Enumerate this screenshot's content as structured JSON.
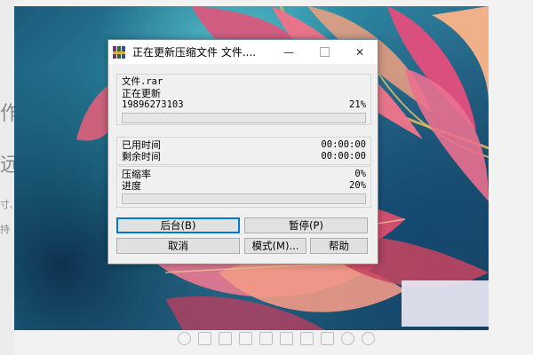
{
  "background_doc": {
    "fragment_1": "作",
    "fragment_2": "远",
    "fragment_3": "寸,",
    "fragment_4": "持"
  },
  "dialog": {
    "title": "正在更新压缩文件 文件....",
    "window_controls": {
      "minimize": "—",
      "maximize": "□",
      "close": "✕"
    },
    "file_section": {
      "filename": "文件.rar",
      "status": "正在更新",
      "current_item": "19896273103",
      "current_percent": "21%",
      "current_progress": 0
    },
    "time_section": {
      "elapsed_label": "已用时间",
      "elapsed_value": "00:00:00",
      "remaining_label": "剩余时间",
      "remaining_value": "00:00:00"
    },
    "ratio_section": {
      "ratio_label": "压缩率",
      "ratio_value": "0%",
      "progress_label": "进度",
      "progress_value": "20%",
      "total_progress": 0
    },
    "buttons": {
      "background": "后台(B)",
      "pause": "暂停(P)",
      "cancel": "取消",
      "mode": "模式(M)...",
      "help": "帮助"
    }
  },
  "colors": {
    "accent": "#0078d7",
    "progress": "#06b025",
    "dialog_bg": "#f0f0f0"
  }
}
